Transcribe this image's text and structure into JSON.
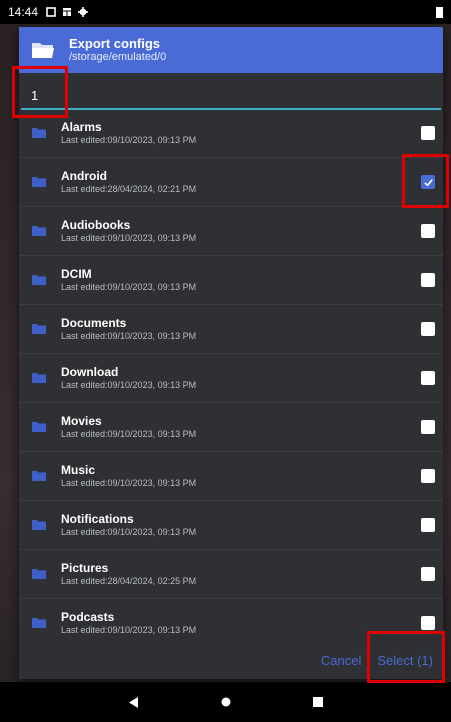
{
  "status_bar": {
    "time": "14:44"
  },
  "dialog": {
    "title": "Export configs",
    "path": "/storage/emulated/0",
    "search_value": "1",
    "cancel_label": "Cancel",
    "select_label": "Select (1)",
    "accent_color": "#4a6bd6"
  },
  "folders": [
    {
      "name": "Alarms",
      "edited": "Last edited:09/10/2023, 09:13 PM",
      "checked": false
    },
    {
      "name": "Android",
      "edited": "Last edited:28/04/2024, 02:21 PM",
      "checked": true
    },
    {
      "name": "Audiobooks",
      "edited": "Last edited:09/10/2023, 09:13 PM",
      "checked": false
    },
    {
      "name": "DCIM",
      "edited": "Last edited:09/10/2023, 09:13 PM",
      "checked": false
    },
    {
      "name": "Documents",
      "edited": "Last edited:09/10/2023, 09:13 PM",
      "checked": false
    },
    {
      "name": "Download",
      "edited": "Last edited:09/10/2023, 09:13 PM",
      "checked": false
    },
    {
      "name": "Movies",
      "edited": "Last edited:09/10/2023, 09:13 PM",
      "checked": false
    },
    {
      "name": "Music",
      "edited": "Last edited:09/10/2023, 09:13 PM",
      "checked": false
    },
    {
      "name": "Notifications",
      "edited": "Last edited:09/10/2023, 09:13 PM",
      "checked": false
    },
    {
      "name": "Pictures",
      "edited": "Last edited:28/04/2024, 02:25 PM",
      "checked": false
    },
    {
      "name": "Podcasts",
      "edited": "Last edited:09/10/2023, 09:13 PM",
      "checked": false
    }
  ]
}
